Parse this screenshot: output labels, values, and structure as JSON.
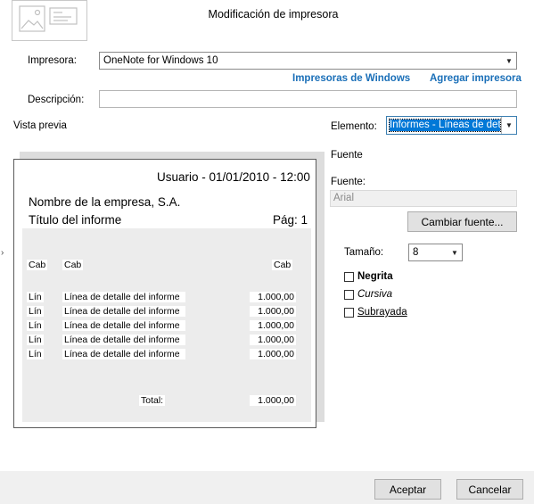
{
  "dialog": {
    "title": "Modificación de impresora"
  },
  "printer": {
    "label": "Impresora:",
    "value": "OneNote for Windows 10",
    "windows_printers_link": "Impresoras de Windows",
    "add_printer_link": "Agregar impresora"
  },
  "description": {
    "label": "Descripción:",
    "value": ""
  },
  "preview": {
    "label": "Vista previa",
    "user_date": "Usuario - 01/01/2010 - 12:00",
    "company": "Nombre de la empresa, S.A.",
    "report_title": "Título del informe",
    "page": "Pág: 1",
    "headers": [
      "Cab",
      "Cab",
      "Cab"
    ],
    "rows": [
      {
        "col1": "Lín",
        "col2": "Línea de detalle del informe",
        "amount": "1.000,00"
      },
      {
        "col1": "Lín",
        "col2": "Línea de detalle del informe",
        "amount": "1.000,00"
      },
      {
        "col1": "Lín",
        "col2": "Línea de detalle del informe",
        "amount": "1.000,00"
      },
      {
        "col1": "Lín",
        "col2": "Línea de detalle del informe",
        "amount": "1.000,00"
      },
      {
        "col1": "Lín",
        "col2": "Línea de detalle del informe",
        "amount": "1.000,00"
      }
    ],
    "total_label": "Total:",
    "total_value": "1.000,00"
  },
  "element": {
    "label": "Elemento:",
    "value": "Informes - Líneas de det"
  },
  "font": {
    "section_title": "Fuente",
    "label": "Fuente:",
    "value": "Arial",
    "change_button": "Cambiar fuente...",
    "size_label": "Tamaño:",
    "size_value": "8",
    "bold_label": "Negrita",
    "italic_label": "Cursiva",
    "underline_label": "Subrayada"
  },
  "buttons": {
    "accept": "Aceptar",
    "cancel": "Cancelar"
  }
}
